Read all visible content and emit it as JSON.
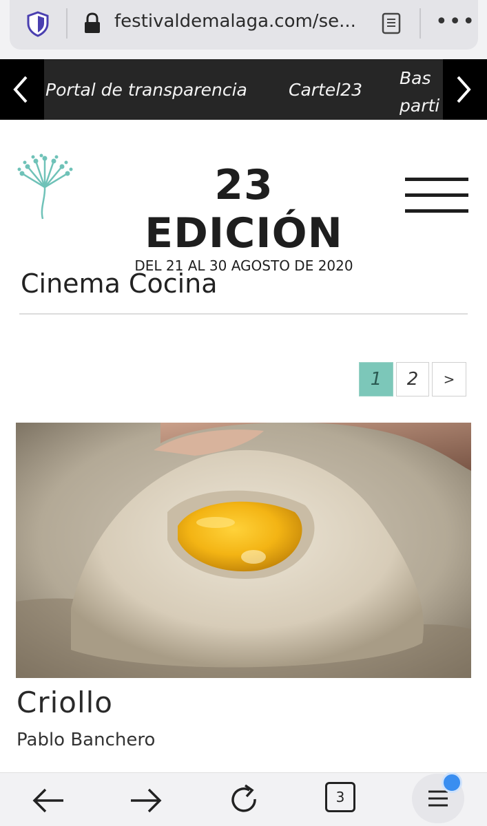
{
  "browser": {
    "url": "festivaldemalaga.com/se...",
    "tabs_count": "3",
    "more_label": "•••"
  },
  "nav": {
    "items": [
      "Portal de transparencia",
      "Cartel23",
      "Bas\nparti"
    ]
  },
  "header": {
    "title": "23 EDICIÓN",
    "dates": "DEL 21 AL 30 AGOSTO DE 2020"
  },
  "section": {
    "title": "Cinema Cocina"
  },
  "pagination": {
    "pages": [
      "1",
      "2"
    ],
    "next": ">",
    "current": "1"
  },
  "film": {
    "title": "Criollo",
    "director": "Pablo Banchero"
  },
  "colors": {
    "accent": "#7cc7b9",
    "nav_bg": "#262626",
    "logo": "#6fc2b8"
  }
}
